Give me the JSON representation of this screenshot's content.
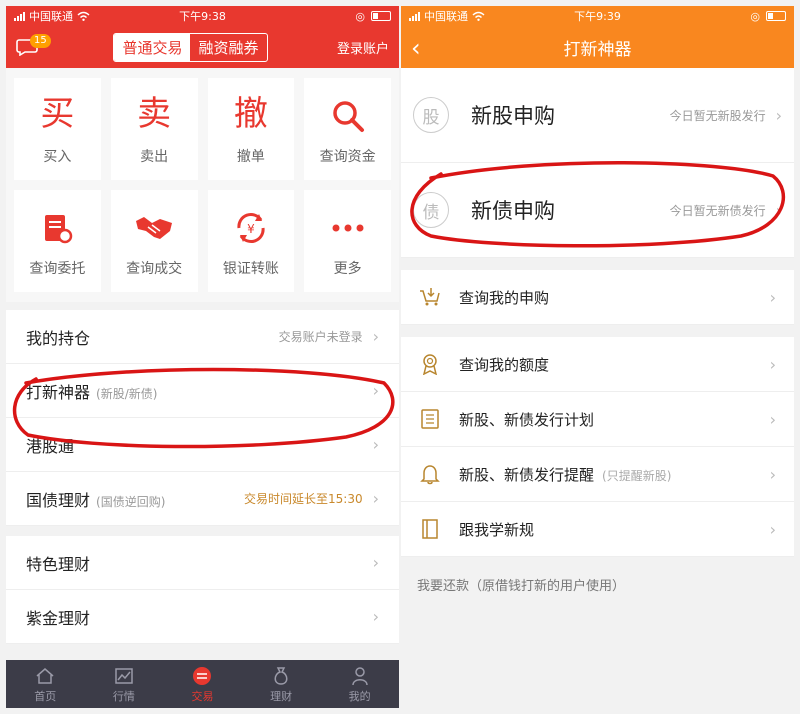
{
  "left": {
    "status": {
      "carrier": "中国联通",
      "time": "下午9:38"
    },
    "header": {
      "badge": "15",
      "seg_active": "普通交易",
      "seg_inactive": "融资融券",
      "login": "登录账户"
    },
    "grid": [
      {
        "label": "买入",
        "glyph": "买"
      },
      {
        "label": "卖出",
        "glyph": "卖"
      },
      {
        "label": "撤单",
        "glyph": "撤"
      },
      {
        "label": "查询资金",
        "icon": "search-icon"
      },
      {
        "label": "查询委托",
        "icon": "order-clipboard-icon"
      },
      {
        "label": "查询成交",
        "icon": "handshake-icon"
      },
      {
        "label": "银证转账",
        "icon": "yen-transfer-icon"
      },
      {
        "label": "更多",
        "icon": "more-dots-icon"
      }
    ],
    "list1": [
      {
        "title": "我的持仓",
        "right": "交易账户未登录"
      },
      {
        "title": "打新神器",
        "sub": "(新股/新债)"
      },
      {
        "title": "港股通"
      },
      {
        "title": "国债理财",
        "sub": "(国债逆回购)",
        "right": "交易时间延长至15:30"
      }
    ],
    "list2": [
      {
        "title": "特色理财"
      },
      {
        "title": "紫金理财"
      }
    ],
    "tabs": [
      {
        "label": "首页",
        "icon": "home-icon"
      },
      {
        "label": "行情",
        "icon": "chart-icon"
      },
      {
        "label": "交易",
        "icon": "trade-icon"
      },
      {
        "label": "理财",
        "icon": "money-bag-icon"
      },
      {
        "label": "我的",
        "icon": "user-icon"
      }
    ],
    "colors": {
      "brand": "#e8382f",
      "gold": "#c9892c",
      "tabbar": "#3c3c48"
    }
  },
  "right": {
    "status": {
      "carrier": "中国联通",
      "time": "下午9:39"
    },
    "header": {
      "title": "打新神器"
    },
    "big": [
      {
        "badge": "股",
        "title": "新股申购",
        "right": "今日暂无新股发行"
      },
      {
        "badge": "债",
        "title": "新债申购",
        "right": "今日暂无新债发行"
      }
    ],
    "list1": [
      {
        "title": "查询我的申购",
        "icon": "cart-download-icon"
      }
    ],
    "list2": [
      {
        "title": "查询我的额度",
        "icon": "award-ribbon-icon"
      },
      {
        "title": "新股、新债发行计划",
        "icon": "list-doc-icon"
      },
      {
        "title": "新股、新债发行提醒",
        "sub": "(只提醒新股)",
        "icon": "bell-icon"
      },
      {
        "title": "跟我学新规",
        "icon": "book-icon"
      }
    ],
    "note": "我要还款（原借钱打新的用户使用）",
    "colors": {
      "brand": "#f9871f",
      "icon": "#b8862f"
    }
  }
}
